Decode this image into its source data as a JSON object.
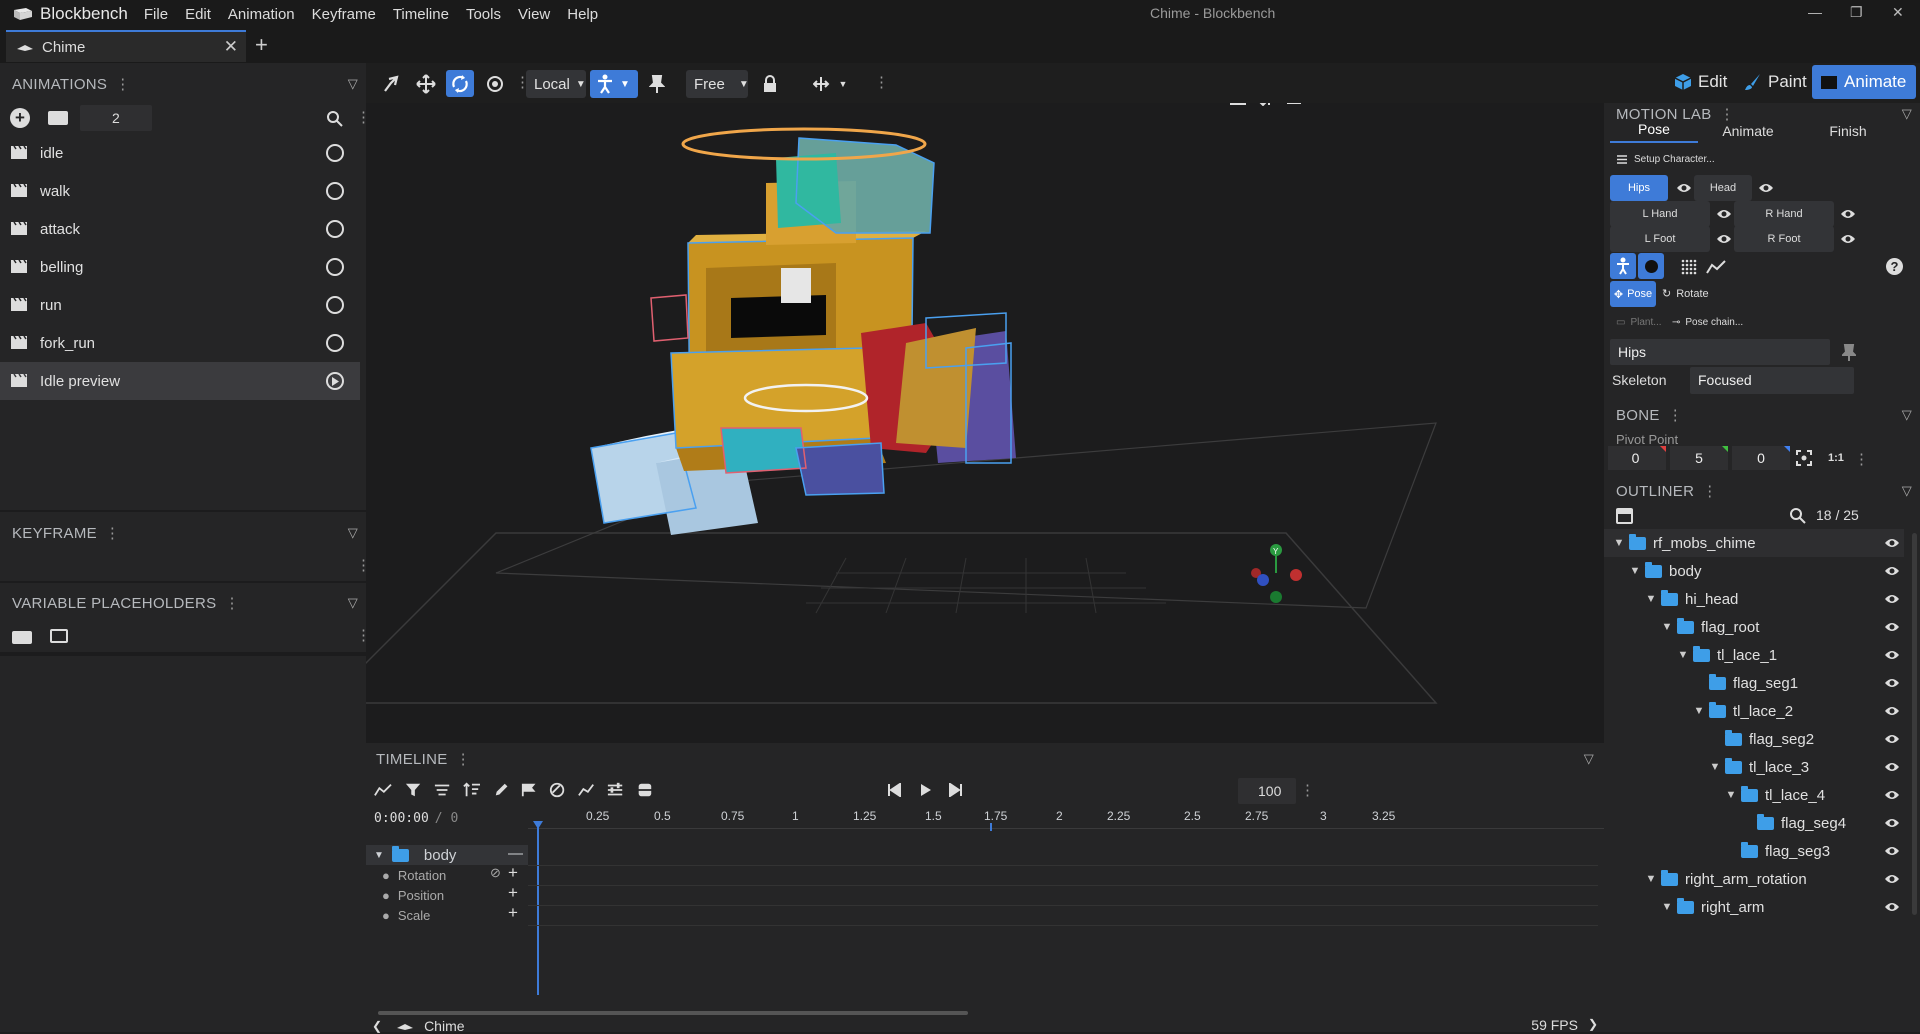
{
  "app": {
    "name": "Blockbench",
    "window_title": "Chime - Blockbench",
    "menu": [
      "File",
      "Edit",
      "Animation",
      "Keyframe",
      "Timeline",
      "Tools",
      "View",
      "Help"
    ]
  },
  "tabs": [
    {
      "label": "Chime"
    }
  ],
  "modes": {
    "edit": "Edit",
    "paint": "Paint",
    "animate": "Animate"
  },
  "toolbar": {
    "space": "Local",
    "pivot_mode": "Free"
  },
  "animations_panel": {
    "title": "ANIMATIONS",
    "count_value": "2",
    "items": [
      {
        "label": "idle"
      },
      {
        "label": "walk"
      },
      {
        "label": "attack"
      },
      {
        "label": "belling"
      },
      {
        "label": "run"
      },
      {
        "label": "fork_run"
      },
      {
        "label": "Idle preview"
      }
    ]
  },
  "keyframe_panel": {
    "title": "KEYFRAME"
  },
  "variable_panel": {
    "title": "VARIABLE PLACEHOLDERS"
  },
  "timeline": {
    "title": "TIMELINE",
    "time": "0:00:00",
    "time_sep": "/ 0",
    "zoom": "100",
    "ticks": [
      "0.25",
      "0.5",
      "0.75",
      "1",
      "1.25",
      "1.5",
      "1.75",
      "2",
      "2.25",
      "2.5",
      "2.75",
      "3",
      "3.25"
    ],
    "group": "body",
    "channels": [
      "Rotation",
      "Position",
      "Scale"
    ],
    "footer_label": "Chime",
    "fps": "59 FPS"
  },
  "motion_lab": {
    "title": "MOTION LAB",
    "tabs": [
      "Pose",
      "Animate",
      "Finish"
    ],
    "setup": "Setup Character...",
    "bones": {
      "hips": "Hips",
      "head": "Head",
      "lhand": "L Hand",
      "rhand": "R Hand",
      "lfoot": "L Foot",
      "rfoot": "R Foot"
    },
    "pose_btn": "Pose",
    "rotate_btn": "Rotate",
    "plant_btn": "Plant...",
    "chain_btn": "Pose chain...",
    "selected_bone": "Hips",
    "skeleton_label": "Skeleton",
    "skeleton_value": "Focused"
  },
  "bone_panel": {
    "title": "BONE",
    "pivot_label": "Pivot Point",
    "pivot": [
      "0",
      "5",
      "0"
    ],
    "ratio": "1:1"
  },
  "outliner": {
    "title": "OUTLINER",
    "count": "18 / 25",
    "rows": [
      {
        "label": "rf_mobs_chime",
        "depth": 0,
        "chev": true
      },
      {
        "label": "body",
        "depth": 1,
        "chev": true
      },
      {
        "label": "hi_head",
        "depth": 2,
        "chev": true
      },
      {
        "label": "flag_root",
        "depth": 3,
        "chev": true
      },
      {
        "label": "tl_lace_1",
        "depth": 4,
        "chev": true
      },
      {
        "label": "flag_seg1",
        "depth": 5,
        "chev": false
      },
      {
        "label": "tl_lace_2",
        "depth": 5,
        "chev": true
      },
      {
        "label": "flag_seg2",
        "depth": 6,
        "chev": false
      },
      {
        "label": "tl_lace_3",
        "depth": 6,
        "chev": true
      },
      {
        "label": "tl_lace_4",
        "depth": 7,
        "chev": true
      },
      {
        "label": "flag_seg4",
        "depth": 8,
        "chev": false
      },
      {
        "label": "flag_seg3",
        "depth": 7,
        "chev": false
      },
      {
        "label": "right_arm_rotation",
        "depth": 2,
        "chev": true
      },
      {
        "label": "right_arm",
        "depth": 3,
        "chev": true
      }
    ]
  },
  "colors": {
    "accent": "#3e7bd8",
    "halo": "#f0a64a"
  }
}
